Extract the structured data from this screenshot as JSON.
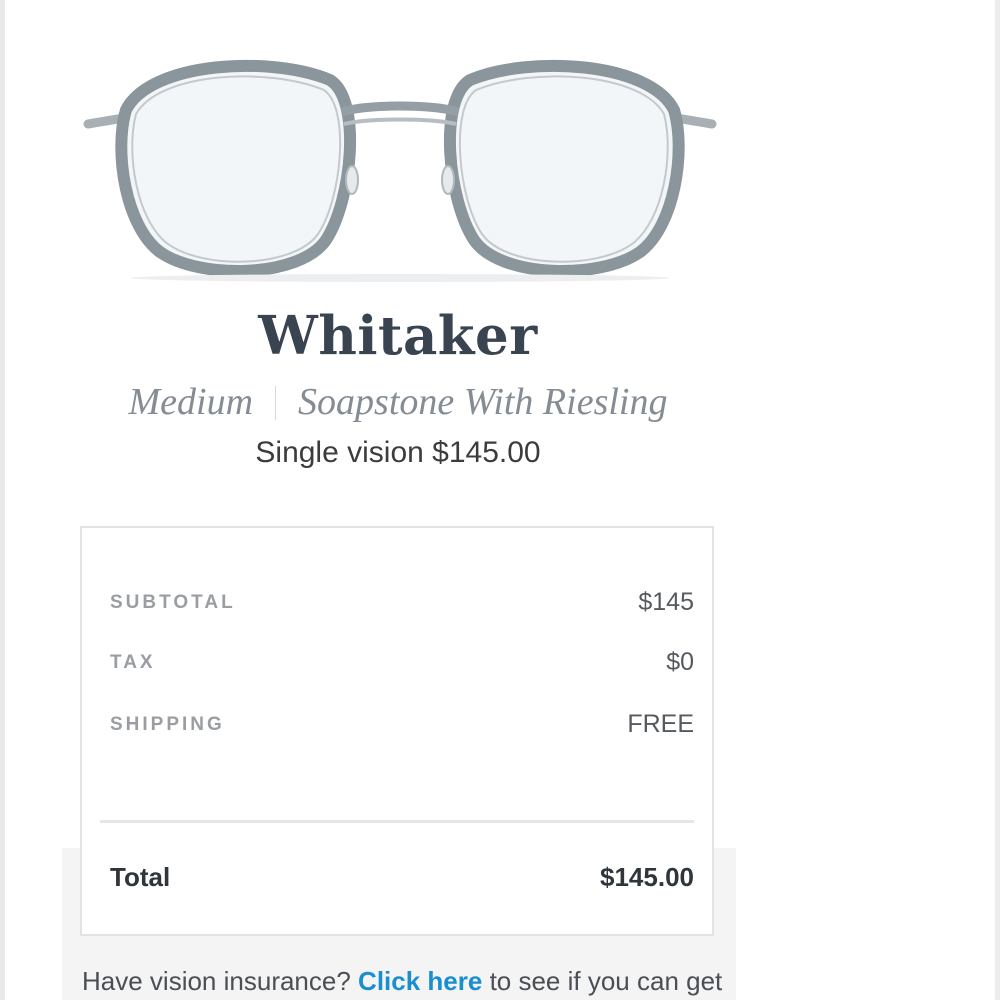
{
  "product": {
    "name": "Whitaker",
    "size": "Medium",
    "color": "Soapstone With Riesling",
    "price_line": "Single vision $145.00"
  },
  "summary": {
    "subtotal_label": "SUBTOTAL",
    "subtotal_value": "$145",
    "tax_label": "TAX",
    "tax_value": "$0",
    "shipping_label": "SHIPPING",
    "shipping_value": "FREE",
    "total_label": "Total",
    "total_value": "$145.00"
  },
  "insurance": {
    "prefix": "Have vision insurance? ",
    "link": "Click here",
    "suffix": " to see if you can get"
  },
  "colors": {
    "frame": "#8b959c",
    "link": "#1a8fd0",
    "title": "#3a4450"
  }
}
